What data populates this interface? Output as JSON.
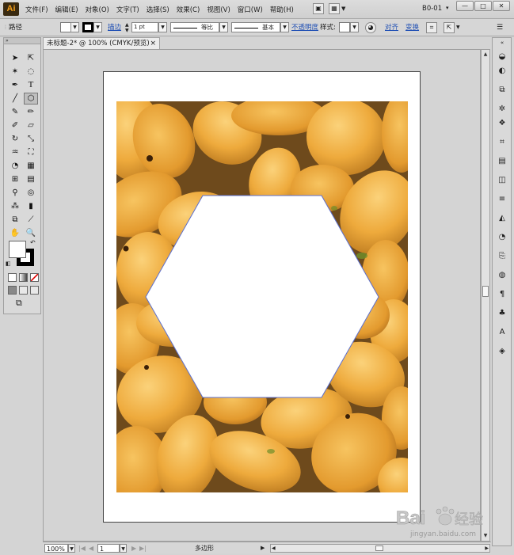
{
  "menubar": {
    "logo": "Ai",
    "items": [
      "文件(F)",
      "编辑(E)",
      "对象(O)",
      "文字(T)",
      "选择(S)",
      "效果(C)",
      "视图(V)",
      "窗口(W)",
      "帮助(H)"
    ],
    "workspace": "B0-01",
    "window_controls": [
      "—",
      "□",
      "✕"
    ]
  },
  "controlbar": {
    "selection_label": "路径",
    "stroke_link": "描边",
    "stroke_weight": "1 pt",
    "profile_label": "等比",
    "brush_label": "基本",
    "opacity_link": "不透明度",
    "style_label": "样式:",
    "align_link": "对齐",
    "transform_link": "变换"
  },
  "document": {
    "tab_title": "未标题-2* @ 100% (CMYK/预览)",
    "tab_close": "×"
  },
  "statusbar": {
    "zoom": "100%",
    "artboard_number": "1",
    "status_text": "多边形"
  },
  "watermark": {
    "brand": "Bai 经验",
    "url": "jingyan.baidu.com"
  },
  "colors": {
    "selection_path": "#5b6fd0",
    "mango": "#f1b548",
    "accent_link": "#1f4fb4"
  }
}
